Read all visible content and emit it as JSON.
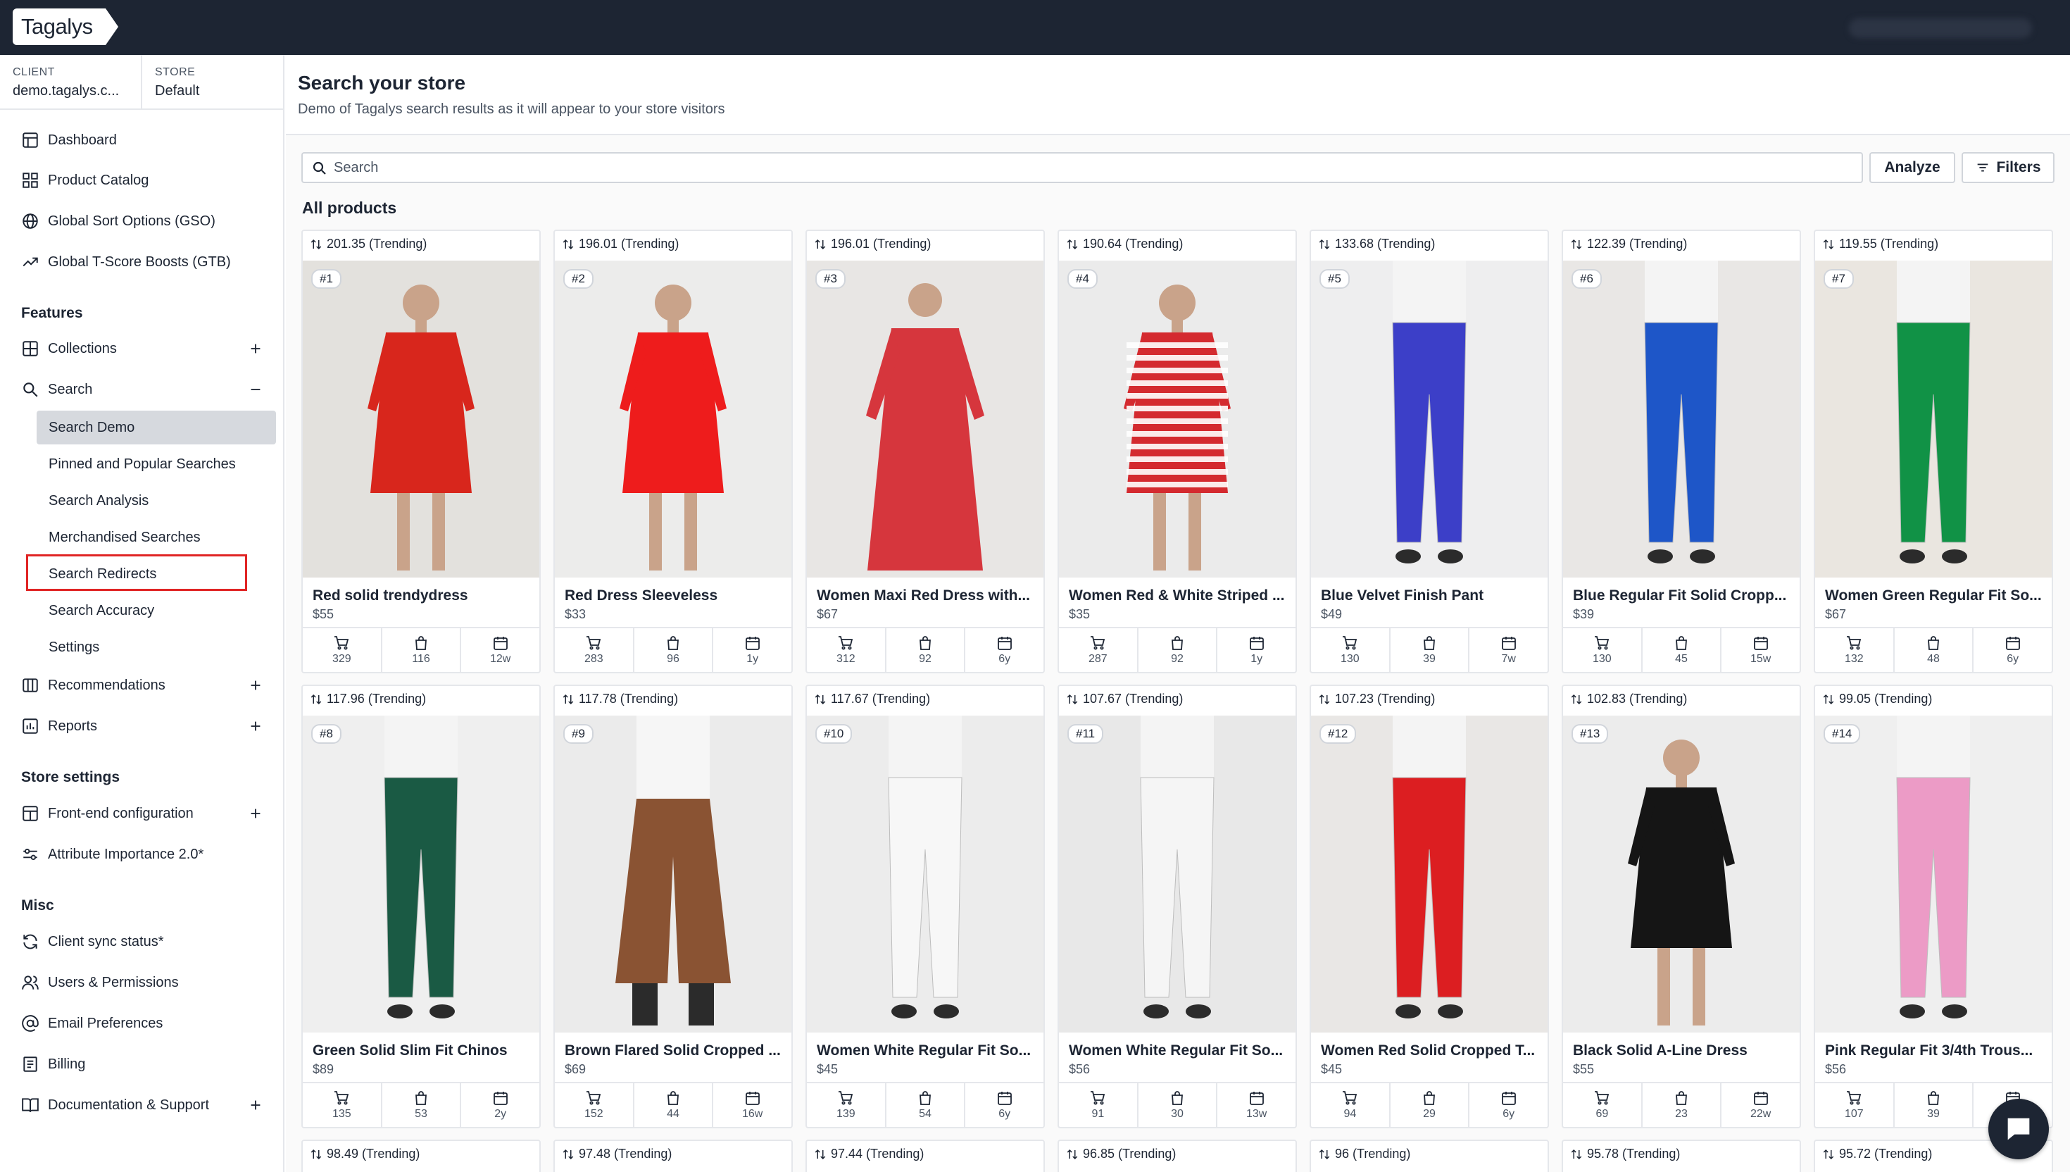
{
  "topbar": {
    "logo": "Tagalys"
  },
  "context": {
    "client_label": "CLIENT",
    "client_value": "demo.tagalys.c...",
    "store_label": "STORE",
    "store_value": "Default"
  },
  "nav": {
    "dashboard": "Dashboard",
    "product_catalog": "Product Catalog",
    "gso": "Global Sort Options (GSO)",
    "gtb": "Global T-Score Boosts (GTB)",
    "features_heading": "Features",
    "collections": "Collections",
    "search": "Search",
    "search_sub": [
      "Search Demo",
      "Pinned and Popular Searches",
      "Search Analysis",
      "Merchandised Searches",
      "Search Redirects",
      "Search Accuracy",
      "Settings"
    ],
    "recommendations": "Recommendations",
    "reports": "Reports",
    "store_settings_heading": "Store settings",
    "frontend_config": "Front-end configuration",
    "attribute_importance": "Attribute Importance 2.0*",
    "misc_heading": "Misc",
    "client_sync": "Client sync status*",
    "users_permissions": "Users & Permissions",
    "email_prefs": "Email Preferences",
    "billing": "Billing",
    "docs_support": "Documentation & Support"
  },
  "main": {
    "title": "Search your store",
    "subtitle": "Demo of Tagalys search results as it will appear to your store visitors",
    "search_placeholder": "Search",
    "analyze_label": "Analyze",
    "filters_label": "Filters",
    "all_products": "All products"
  },
  "products": [
    {
      "score": "201.35 (Trending)",
      "rank": "#1",
      "name": "Red solid trendydress",
      "price": "$55",
      "cart": "329",
      "bag": "116",
      "age": "12w",
      "bg": "#e3e1dd",
      "color": "#d8261c",
      "shape": "dress"
    },
    {
      "score": "196.01 (Trending)",
      "rank": "#2",
      "name": "Red Dress Sleeveless",
      "price": "$33",
      "cart": "283",
      "bag": "96",
      "age": "1y",
      "bg": "#ececeb",
      "color": "#ee1c1c",
      "shape": "dress"
    },
    {
      "score": "196.01 (Trending)",
      "rank": "#3",
      "name": "Women Maxi Red Dress with...",
      "price": "$67",
      "cart": "312",
      "bag": "92",
      "age": "6y",
      "bg": "#e8e6e4",
      "color": "#d6363d",
      "shape": "maxi"
    },
    {
      "score": "190.64 (Trending)",
      "rank": "#4",
      "name": "Women Red & White Striped ...",
      "price": "$35",
      "cart": "287",
      "bag": "92",
      "age": "1y",
      "bg": "#ebebeb",
      "color": "#d42a2f",
      "shape": "stripe"
    },
    {
      "score": "133.68 (Trending)",
      "rank": "#5",
      "name": "Blue Velvet Finish Pant",
      "price": "$49",
      "cart": "130",
      "bag": "39",
      "age": "7w",
      "bg": "#eeeeef",
      "color": "#3c3fc8",
      "shape": "pant"
    },
    {
      "score": "122.39 (Trending)",
      "rank": "#6",
      "name": "Blue Regular Fit Solid Cropp...",
      "price": "$39",
      "cart": "130",
      "bag": "45",
      "age": "15w",
      "bg": "#e9e7e5",
      "color": "#1e56c8",
      "shape": "pant"
    },
    {
      "score": "119.55 (Trending)",
      "rank": "#7",
      "name": "Women Green Regular Fit So...",
      "price": "$67",
      "cart": "132",
      "bag": "48",
      "age": "6y",
      "bg": "#eae6e0",
      "color": "#119246",
      "shape": "pant"
    },
    {
      "score": "117.96 (Trending)",
      "rank": "#8",
      "name": "Green Solid Slim Fit Chinos",
      "price": "$89",
      "cart": "135",
      "bag": "53",
      "age": "2y",
      "bg": "#efefef",
      "color": "#1a5a44",
      "shape": "pant"
    },
    {
      "score": "117.78 (Trending)",
      "rank": "#9",
      "name": "Brown Flared Solid Cropped ...",
      "price": "$69",
      "cart": "152",
      "bag": "44",
      "age": "16w",
      "bg": "#ebebeb",
      "color": "#8a5333",
      "shape": "culotte"
    },
    {
      "score": "117.67 (Trending)",
      "rank": "#10",
      "name": "Women White Regular Fit So...",
      "price": "$45",
      "cart": "139",
      "bag": "54",
      "age": "6y",
      "bg": "#ececec",
      "color": "#f7f7f7",
      "shape": "pant"
    },
    {
      "score": "107.67 (Trending)",
      "rank": "#11",
      "name": "Women White Regular Fit So...",
      "price": "$56",
      "cart": "91",
      "bag": "30",
      "age": "13w",
      "bg": "#e8e8e8",
      "color": "#f5f5f5",
      "shape": "pant"
    },
    {
      "score": "107.23 (Trending)",
      "rank": "#12",
      "name": "Women Red Solid Cropped T...",
      "price": "$45",
      "cart": "94",
      "bag": "29",
      "age": "6y",
      "bg": "#e9e7e5",
      "color": "#dc1e21",
      "shape": "pant"
    },
    {
      "score": "102.83 (Trending)",
      "rank": "#13",
      "name": "Black Solid A-Line Dress",
      "price": "$55",
      "cart": "69",
      "bag": "23",
      "age": "22w",
      "bg": "#ececec",
      "color": "#151515",
      "shape": "dress"
    },
    {
      "score": "99.05 (Trending)",
      "rank": "#14",
      "name": "Pink Regular Fit 3/4th Trous...",
      "price": "$56",
      "cart": "107",
      "bag": "39",
      "age": "6y",
      "bg": "#efefef",
      "color": "#ec9bc6",
      "shape": "pant"
    },
    {
      "score": "98.49 (Trending)"
    },
    {
      "score": "97.48 (Trending)"
    },
    {
      "score": "97.44 (Trending)"
    },
    {
      "score": "96.85 (Trending)"
    },
    {
      "score": "96 (Trending)"
    },
    {
      "score": "95.78 (Trending)"
    },
    {
      "score": "95.72 (Trending)"
    }
  ],
  "colors": {
    "topbar": "#1d2533",
    "active_item": "#d6d9de",
    "highlight": "#e02424"
  }
}
